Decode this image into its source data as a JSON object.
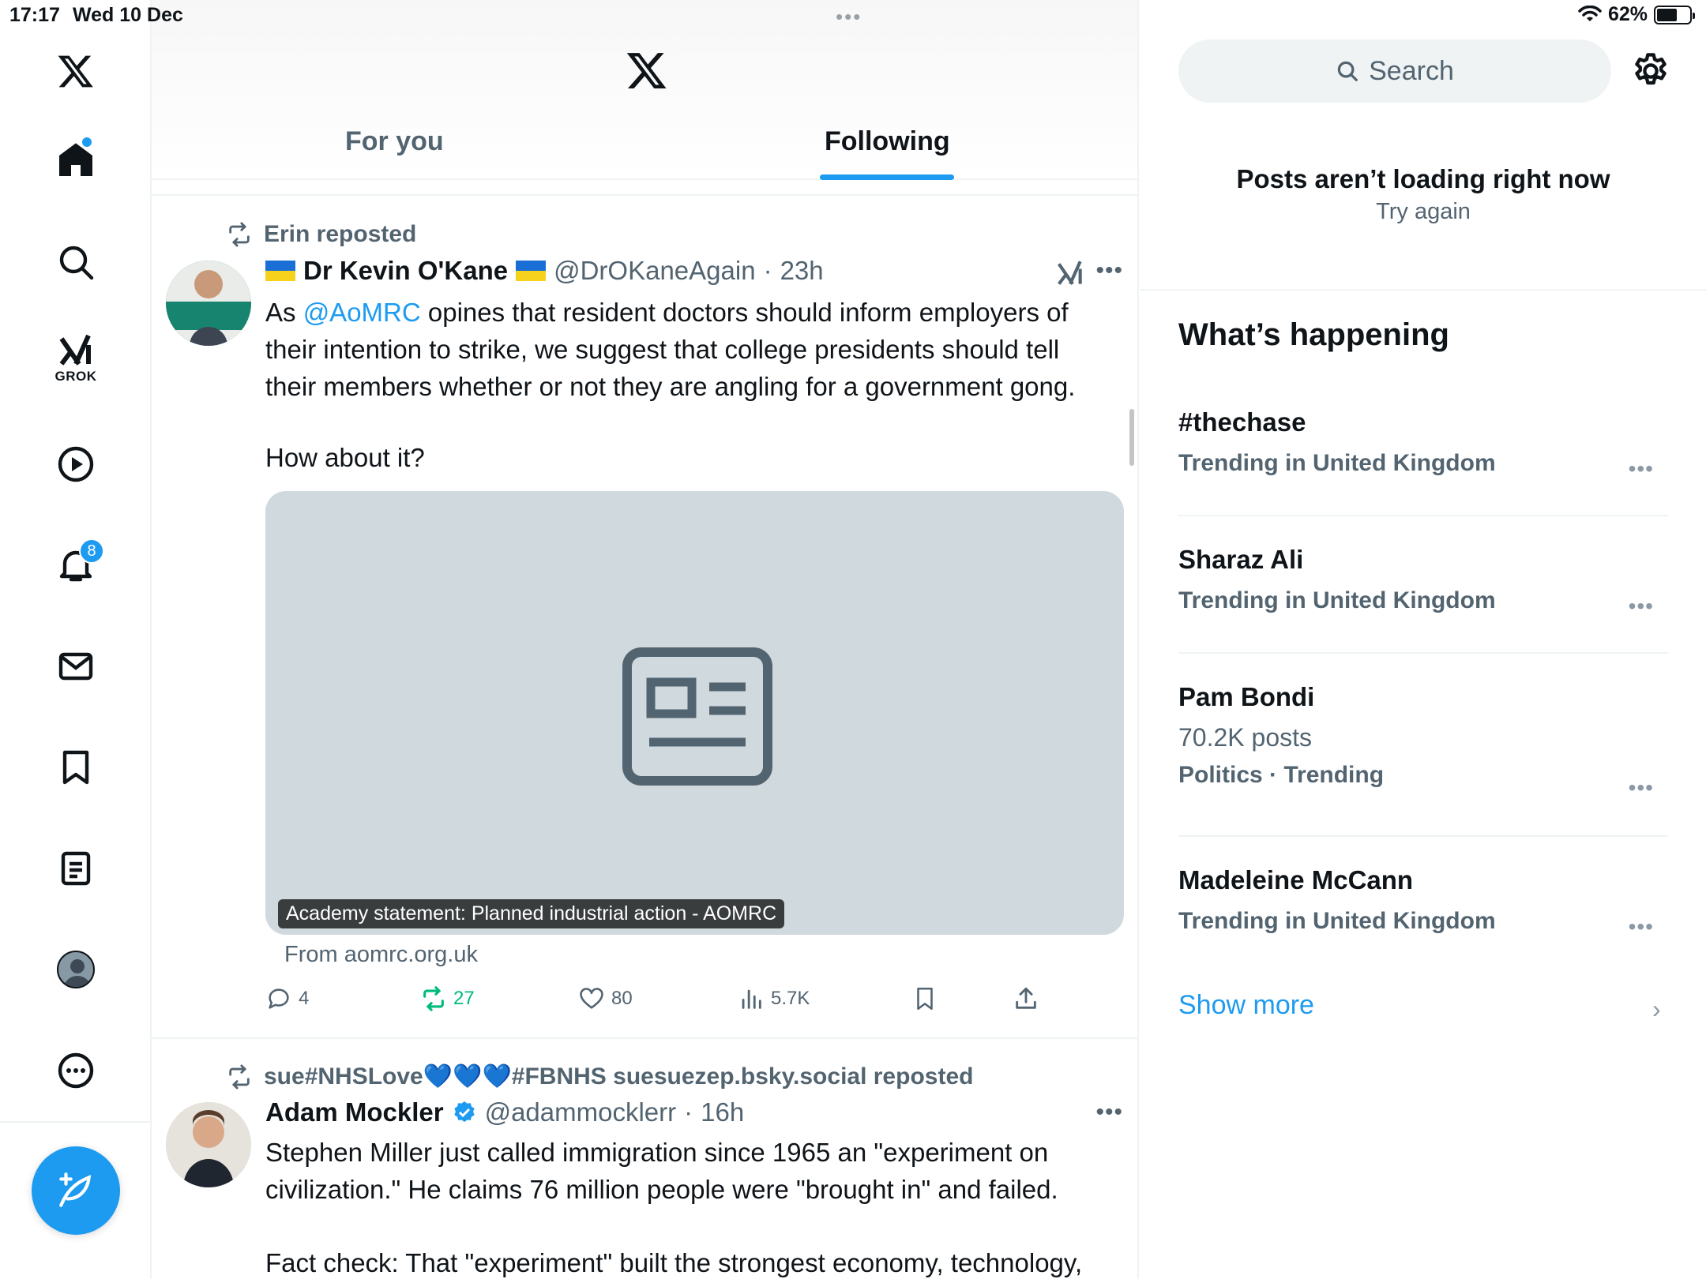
{
  "status_bar": {
    "time": "17:17",
    "date": "Wed 10 Dec",
    "battery": "62%",
    "battery_level": 0.62
  },
  "sidebar": {
    "items": [
      {
        "name": "home",
        "icon": "home-icon"
      },
      {
        "name": "explore",
        "icon": "search-icon"
      },
      {
        "name": "grok",
        "icon": "grok-icon",
        "label": "GROK"
      },
      {
        "name": "videos",
        "icon": "play-icon"
      },
      {
        "name": "notifications",
        "icon": "bell-icon",
        "badge": "8"
      },
      {
        "name": "messages",
        "icon": "mail-icon"
      },
      {
        "name": "bookmarks",
        "icon": "bookmark-icon"
      },
      {
        "name": "lists",
        "icon": "list-icon"
      },
      {
        "name": "profile",
        "icon": "avatar"
      },
      {
        "name": "more",
        "icon": "more-circle-icon"
      }
    ]
  },
  "header": {
    "tabs": [
      {
        "label": "For you",
        "active": false
      },
      {
        "label": "Following",
        "active": true
      }
    ]
  },
  "feed": [
    {
      "repost_by": "Erin reposted",
      "display_name": "Dr Kevin O'Kane",
      "handle": "@DrOKaneAgain",
      "time": "23h",
      "text_prefix": "As ",
      "mention": "@AoMRC",
      "text_suffix": " opines that resident doctors should inform employers of their intention to strike, we suggest that college presidents should tell their members whether or not they are angling for a government gong.",
      "text_2": "How about it?",
      "card": {
        "title": "Academy statement: Planned industrial action - AOMRC",
        "source": "From aomrc.org.uk"
      },
      "stats": {
        "replies": "4",
        "reposts": "27",
        "likes": "80",
        "views": "5.7K"
      }
    },
    {
      "repost_by": "sue#NHSLove💙💙💙#FBNHS suesuezep.bsky.social reposted",
      "display_name": "Adam Mockler",
      "handle": "@adammocklerr",
      "time": "16h",
      "verified": true,
      "text": "Stephen Miller just called immigration since 1965 an \"experiment on civilization.\" He claims 76 million people were \"brought in\" and failed.",
      "text_2": "Fact check: That \"experiment\" built the strongest economy, technology,"
    }
  ],
  "right": {
    "search_placeholder": "Search",
    "error_title": "Posts aren’t loading right now",
    "error_action": "Try again",
    "section_title": "What’s happening",
    "trends": [
      {
        "name": "#thechase",
        "meta": "Trending in United Kingdom"
      },
      {
        "name": "Sharaz Ali",
        "meta": "Trending in United Kingdom"
      },
      {
        "name": "Pam Bondi",
        "posts": "70.2K posts",
        "meta": "Politics · Trending"
      },
      {
        "name": "Madeleine McCann",
        "meta": "Trending in United Kingdom"
      }
    ],
    "show_more": "Show more"
  },
  "colors": {
    "accent": "#1d9bf0",
    "repost_green": "#00ba7c",
    "muted": "#536471"
  }
}
